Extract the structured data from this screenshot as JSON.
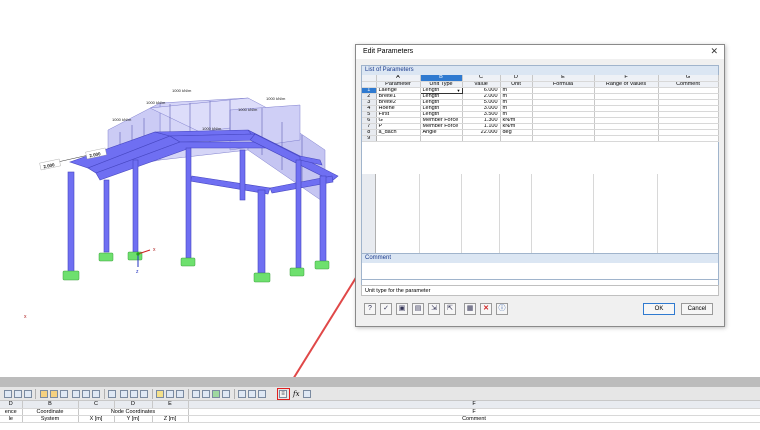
{
  "model_view": {
    "loads": [
      "1000 kN/m",
      "1000 kN/m",
      "1000 kN/m",
      "1000 kN/m",
      "1000 kN/m",
      "1000 kN/m"
    ],
    "dimensions": [
      "2.000",
      "2.000"
    ],
    "axis_x": "x",
    "axis_z": "z",
    "stray_x_left": "x"
  },
  "dialog": {
    "title": "Edit Parameters",
    "close_glyph": "✕",
    "list_title": "List of Parameters",
    "columns": {
      "letters": [
        "A",
        "B",
        "C",
        "D",
        "E",
        "F",
        "G"
      ],
      "headers": [
        "Parameter",
        "Unit Type",
        "Value",
        "Unit",
        "Formula",
        "Range of Values",
        "Comment"
      ]
    },
    "rows": [
      {
        "no": "1",
        "parameter": "Laenge",
        "unit_type": "Length",
        "value": "6.000",
        "unit": "m"
      },
      {
        "no": "2",
        "parameter": "Breite1",
        "unit_type": "Length",
        "value": "2.000",
        "unit": "m"
      },
      {
        "no": "3",
        "parameter": "Breite2",
        "unit_type": "Length",
        "value": "5.000",
        "unit": "m"
      },
      {
        "no": "4",
        "parameter": "Hoehe",
        "unit_type": "Length",
        "value": "3.000",
        "unit": "m"
      },
      {
        "no": "5",
        "parameter": "First",
        "unit_type": "Length",
        "value": "3.500",
        "unit": "m"
      },
      {
        "no": "6",
        "parameter": "G",
        "unit_type": "Member Force",
        "value": "1.300",
        "unit": "kN/m"
      },
      {
        "no": "7",
        "parameter": "P",
        "unit_type": "Member Force",
        "value": "1.100",
        "unit": "kN/m"
      },
      {
        "no": "8",
        "parameter": "a_dach",
        "unit_type": "Angle",
        "value": "22.000",
        "unit": "deg"
      },
      {
        "no": "9",
        "parameter": "",
        "unit_type": "",
        "value": "",
        "unit": ""
      }
    ],
    "comment_title": "Comment",
    "hint": "Unit type for the parameter",
    "ok_label": "OK",
    "cancel_label": "Cancel",
    "icon_buttons": [
      "help-icon",
      "check-icon",
      "save-icon",
      "open-icon",
      "import-icon",
      "export-icon",
      "grid-icon",
      "delete-icon",
      "info-icon"
    ]
  },
  "bottom": {
    "column_letters": [
      "D",
      "B",
      "C",
      "D",
      "E",
      "F"
    ],
    "header_row1": [
      "ence",
      "Coordinate",
      "Node Coordinates",
      "",
      "",
      "F"
    ],
    "header_row2": [
      "le",
      "System",
      "X [m]",
      "Y [m]",
      "Z [m]",
      "Comment"
    ],
    "toolbar_fx": "fx"
  },
  "colors": {
    "member": "#6f6ff2",
    "support": "#6ee06e",
    "load_fill": "#c9c9f5",
    "selected": "#2f7ad0",
    "arrow": "#e04848"
  }
}
